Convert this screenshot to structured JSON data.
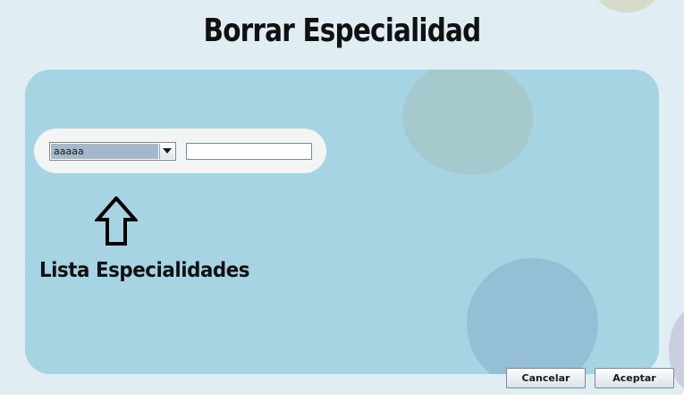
{
  "window": {
    "title": "Borrar Especialidad"
  },
  "form": {
    "especialidad_combo": {
      "selected": "aaaaa"
    },
    "text_field": {
      "value": ""
    },
    "list_label": "Lista Especialidades"
  },
  "buttons": {
    "cancel_label": "Cancelar",
    "accept_label": "Aceptar"
  },
  "icons": {
    "up_arrow": "arrow-up-outline-icon",
    "combo_arrow": "chevron-down-icon"
  },
  "colors": {
    "background": "#e0eef3",
    "panel": "#a7d4e2",
    "combo_selection": "#a3b8cc"
  }
}
